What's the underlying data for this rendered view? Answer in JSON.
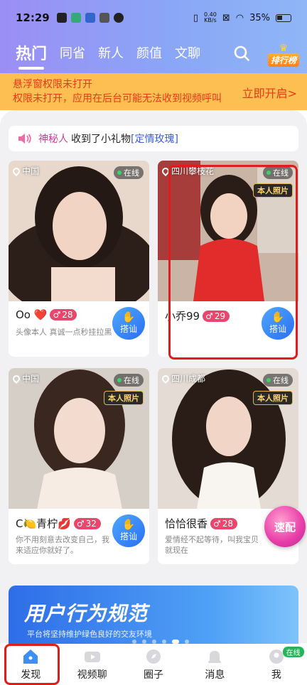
{
  "status_bar": {
    "time": "12:29",
    "net_speed_value": "0.40",
    "net_speed_unit": "KB/s",
    "battery": "35%"
  },
  "tabs": [
    {
      "label": "热门",
      "active": true
    },
    {
      "label": "同省",
      "active": false
    },
    {
      "label": "新人",
      "active": false
    },
    {
      "label": "颜值",
      "active": false
    },
    {
      "label": "文聊",
      "active": false
    }
  ],
  "rank_label": "排行榜",
  "notice": {
    "line1": "悬浮窗权限未打开",
    "line2": "权限未打开，应用在后台可能无法收到视频呼叫",
    "action": "立即开启>"
  },
  "gift_bar": {
    "who": "神秘人",
    "text": "收到了小礼物",
    "gift": "[定情玫瑰]"
  },
  "online_label": "在线",
  "verified_label": "本人照片",
  "chat_label": "搭讪",
  "cards": [
    {
      "location": "中国",
      "name": "Oo ❤️",
      "level": "28",
      "bio": "头像本人 真诚一点秒挂拉黑",
      "verified": false
    },
    {
      "location": "四川攀枝花",
      "name": "小乔99",
      "level": "29",
      "bio": "",
      "verified": true
    },
    {
      "location": "中国",
      "name": "C🍋青柠💋",
      "level": "32",
      "bio": "你不用刻意去改变自己，我来适应你就好了。",
      "verified": true
    },
    {
      "location": "四川成都",
      "name": "恰恰很香",
      "level": "28",
      "bio": "爱情经不起等待，叫我宝贝就现在",
      "verified": true
    }
  ],
  "speed_match": "速配",
  "banner": {
    "title": "用户行为规范",
    "subtitle": "平台将坚持维护绿色良好的交友环境"
  },
  "bottom_nav": [
    {
      "label": "发现"
    },
    {
      "label": "视频聊"
    },
    {
      "label": "圈子"
    },
    {
      "label": "消息"
    },
    {
      "label": "我",
      "badge": "在线"
    }
  ]
}
